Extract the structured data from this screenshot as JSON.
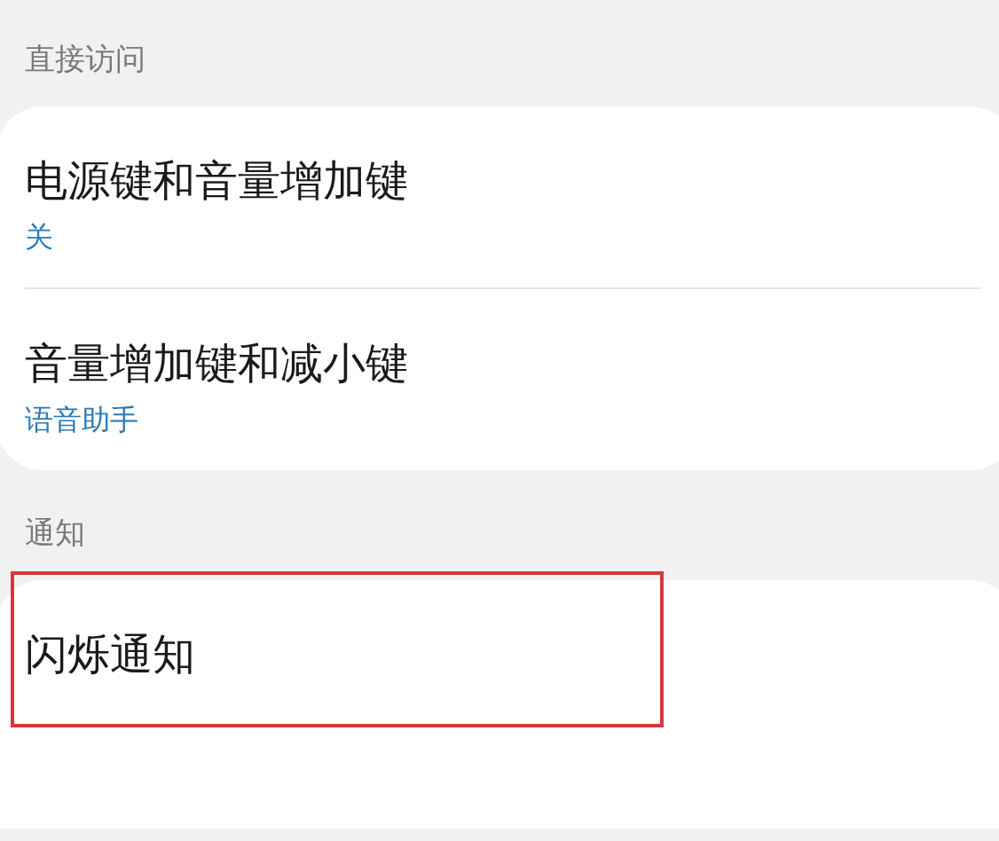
{
  "sections": [
    {
      "header": "直接访问",
      "items": [
        {
          "title": "电源键和音量增加键",
          "subtitle": "关",
          "highlighted": false
        },
        {
          "title": "音量增加键和减小键",
          "subtitle": "语音助手",
          "highlighted": false
        }
      ]
    },
    {
      "header": "通知",
      "items": [
        {
          "title": "闪烁通知",
          "highlighted": true
        }
      ]
    }
  ]
}
